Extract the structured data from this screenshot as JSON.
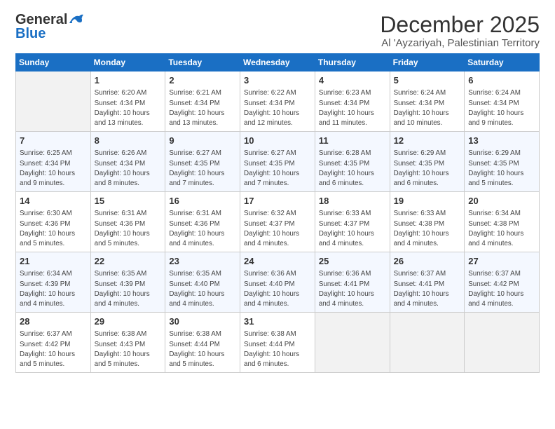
{
  "header": {
    "logo_general": "General",
    "logo_blue": "Blue",
    "title": "December 2025",
    "subtitle": "Al 'Ayzariyah, Palestinian Territory"
  },
  "days_of_week": [
    "Sunday",
    "Monday",
    "Tuesday",
    "Wednesday",
    "Thursday",
    "Friday",
    "Saturday"
  ],
  "weeks": [
    [
      {
        "day": "",
        "info": ""
      },
      {
        "day": "1",
        "info": "Sunrise: 6:20 AM\nSunset: 4:34 PM\nDaylight: 10 hours\nand 13 minutes."
      },
      {
        "day": "2",
        "info": "Sunrise: 6:21 AM\nSunset: 4:34 PM\nDaylight: 10 hours\nand 13 minutes."
      },
      {
        "day": "3",
        "info": "Sunrise: 6:22 AM\nSunset: 4:34 PM\nDaylight: 10 hours\nand 12 minutes."
      },
      {
        "day": "4",
        "info": "Sunrise: 6:23 AM\nSunset: 4:34 PM\nDaylight: 10 hours\nand 11 minutes."
      },
      {
        "day": "5",
        "info": "Sunrise: 6:24 AM\nSunset: 4:34 PM\nDaylight: 10 hours\nand 10 minutes."
      },
      {
        "day": "6",
        "info": "Sunrise: 6:24 AM\nSunset: 4:34 PM\nDaylight: 10 hours\nand 9 minutes."
      }
    ],
    [
      {
        "day": "7",
        "info": "Sunrise: 6:25 AM\nSunset: 4:34 PM\nDaylight: 10 hours\nand 9 minutes."
      },
      {
        "day": "8",
        "info": "Sunrise: 6:26 AM\nSunset: 4:34 PM\nDaylight: 10 hours\nand 8 minutes."
      },
      {
        "day": "9",
        "info": "Sunrise: 6:27 AM\nSunset: 4:35 PM\nDaylight: 10 hours\nand 7 minutes."
      },
      {
        "day": "10",
        "info": "Sunrise: 6:27 AM\nSunset: 4:35 PM\nDaylight: 10 hours\nand 7 minutes."
      },
      {
        "day": "11",
        "info": "Sunrise: 6:28 AM\nSunset: 4:35 PM\nDaylight: 10 hours\nand 6 minutes."
      },
      {
        "day": "12",
        "info": "Sunrise: 6:29 AM\nSunset: 4:35 PM\nDaylight: 10 hours\nand 6 minutes."
      },
      {
        "day": "13",
        "info": "Sunrise: 6:29 AM\nSunset: 4:35 PM\nDaylight: 10 hours\nand 5 minutes."
      }
    ],
    [
      {
        "day": "14",
        "info": "Sunrise: 6:30 AM\nSunset: 4:36 PM\nDaylight: 10 hours\nand 5 minutes."
      },
      {
        "day": "15",
        "info": "Sunrise: 6:31 AM\nSunset: 4:36 PM\nDaylight: 10 hours\nand 5 minutes."
      },
      {
        "day": "16",
        "info": "Sunrise: 6:31 AM\nSunset: 4:36 PM\nDaylight: 10 hours\nand 4 minutes."
      },
      {
        "day": "17",
        "info": "Sunrise: 6:32 AM\nSunset: 4:37 PM\nDaylight: 10 hours\nand 4 minutes."
      },
      {
        "day": "18",
        "info": "Sunrise: 6:33 AM\nSunset: 4:37 PM\nDaylight: 10 hours\nand 4 minutes."
      },
      {
        "day": "19",
        "info": "Sunrise: 6:33 AM\nSunset: 4:38 PM\nDaylight: 10 hours\nand 4 minutes."
      },
      {
        "day": "20",
        "info": "Sunrise: 6:34 AM\nSunset: 4:38 PM\nDaylight: 10 hours\nand 4 minutes."
      }
    ],
    [
      {
        "day": "21",
        "info": "Sunrise: 6:34 AM\nSunset: 4:39 PM\nDaylight: 10 hours\nand 4 minutes."
      },
      {
        "day": "22",
        "info": "Sunrise: 6:35 AM\nSunset: 4:39 PM\nDaylight: 10 hours\nand 4 minutes."
      },
      {
        "day": "23",
        "info": "Sunrise: 6:35 AM\nSunset: 4:40 PM\nDaylight: 10 hours\nand 4 minutes."
      },
      {
        "day": "24",
        "info": "Sunrise: 6:36 AM\nSunset: 4:40 PM\nDaylight: 10 hours\nand 4 minutes."
      },
      {
        "day": "25",
        "info": "Sunrise: 6:36 AM\nSunset: 4:41 PM\nDaylight: 10 hours\nand 4 minutes."
      },
      {
        "day": "26",
        "info": "Sunrise: 6:37 AM\nSunset: 4:41 PM\nDaylight: 10 hours\nand 4 minutes."
      },
      {
        "day": "27",
        "info": "Sunrise: 6:37 AM\nSunset: 4:42 PM\nDaylight: 10 hours\nand 4 minutes."
      }
    ],
    [
      {
        "day": "28",
        "info": "Sunrise: 6:37 AM\nSunset: 4:42 PM\nDaylight: 10 hours\nand 5 minutes."
      },
      {
        "day": "29",
        "info": "Sunrise: 6:38 AM\nSunset: 4:43 PM\nDaylight: 10 hours\nand 5 minutes."
      },
      {
        "day": "30",
        "info": "Sunrise: 6:38 AM\nSunset: 4:44 PM\nDaylight: 10 hours\nand 5 minutes."
      },
      {
        "day": "31",
        "info": "Sunrise: 6:38 AM\nSunset: 4:44 PM\nDaylight: 10 hours\nand 6 minutes."
      },
      {
        "day": "",
        "info": ""
      },
      {
        "day": "",
        "info": ""
      },
      {
        "day": "",
        "info": ""
      }
    ]
  ]
}
